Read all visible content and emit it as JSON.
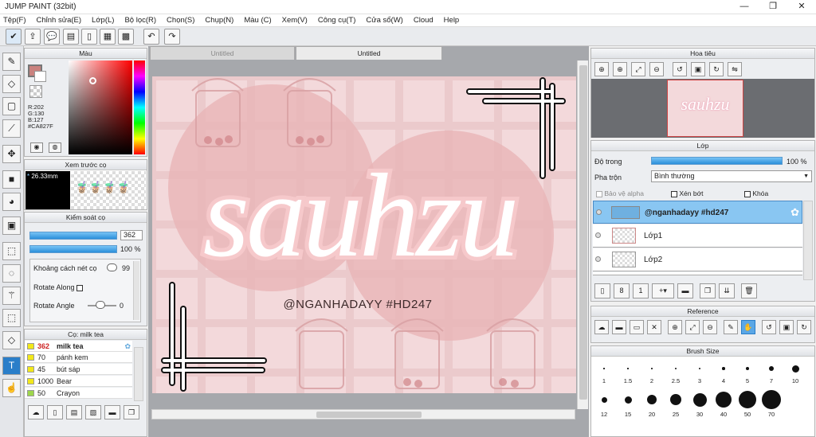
{
  "app": {
    "title": "JUMP PAINT (32bit)"
  },
  "menu": [
    "Tệp(F)",
    "Chỉnh sửa(E)",
    "Lớp(L)",
    "Bộ lọc(R)",
    "Chọn(S)",
    "Chụp(N)",
    "Màu (C)",
    "Xem(V)",
    "Công cụ(T)",
    "Cửa sổ(W)",
    "Cloud",
    "Help"
  ],
  "tabs": {
    "tab1": "Untitled",
    "tab2": "Untitled"
  },
  "color_panel": {
    "title": "Màu",
    "r": "R:202",
    "g": "G:130",
    "b": "B:127",
    "hex": "#CA827F",
    "main_color": "#ca827f"
  },
  "preview_panel": {
    "title": "Xem trước cọ",
    "size": "26.33mm"
  },
  "brush_control": {
    "title": "Kiểm soát cọ",
    "size_value": "362",
    "opacity_value": "100 %",
    "spacing_label": "Khoảng cách nét cọ",
    "spacing_value": "99",
    "rotate_along_label": "Rotate Along",
    "rotate_angle_label": "Rotate Angle",
    "rotate_angle_value": "0"
  },
  "brush_list": {
    "title": "Cọ: milk tea",
    "items": [
      {
        "size": "362",
        "name": "milk tea"
      },
      {
        "size": "70",
        "name": "pánh kem"
      },
      {
        "size": "45",
        "name": "bút sáp"
      },
      {
        "size": "1000",
        "name": "Bear"
      },
      {
        "size": "50",
        "name": "Crayon"
      }
    ]
  },
  "navigator": {
    "title": "Hoa tiêu"
  },
  "layers": {
    "title": "Lớp",
    "opacity_label": "Độ trong",
    "opacity_value": "100 %",
    "blend_label": "Pha trộn",
    "blend_value": "Bình thường",
    "protect_alpha": "Bảo vệ alpha",
    "clip": "Xén bớt",
    "lock": "Khóa",
    "items": [
      {
        "name": "@nganhadayy #hd247"
      },
      {
        "name": "Lớp1"
      },
      {
        "name": "Lớp2"
      }
    ]
  },
  "reference": {
    "title": "Reference"
  },
  "brush_size": {
    "title": "Brush Size",
    "row1": [
      "1",
      "1.5",
      "2",
      "2.5",
      "3",
      "4",
      "5",
      "7",
      "10"
    ],
    "row2": [
      "12",
      "15",
      "20",
      "25",
      "30",
      "40",
      "50",
      "70"
    ]
  },
  "artwork": {
    "main_text": "sauhzu",
    "handle": "@NGANHADAYY #HD247",
    "bg": "#f3d9db",
    "circle": "#e8b4b6"
  }
}
